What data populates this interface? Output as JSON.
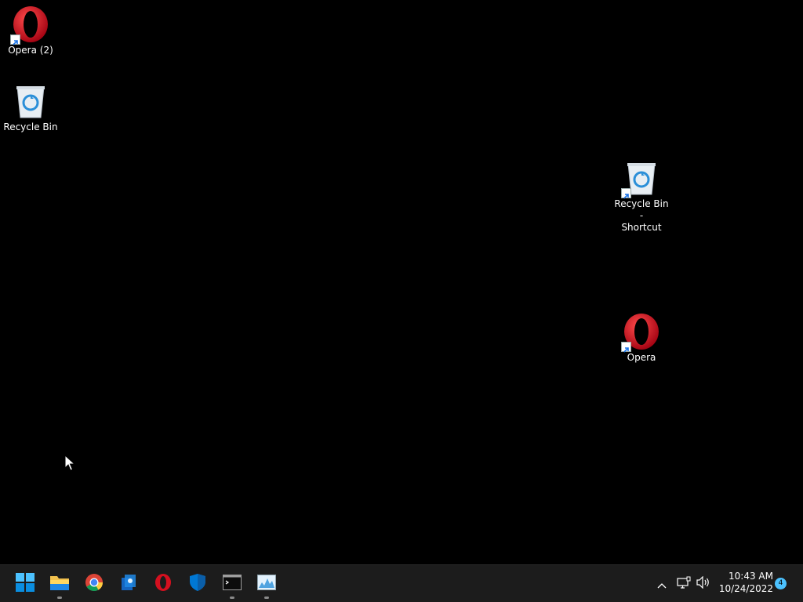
{
  "desktop": {
    "icons": [
      {
        "label": "Opera (2)",
        "icon": "opera-icon",
        "shortcut": true
      },
      {
        "label": "Recycle Bin",
        "icon": "recycle-bin-icon",
        "shortcut": false
      },
      {
        "label_line1": "Recycle Bin -",
        "label_line2": "Shortcut",
        "icon": "recycle-bin-icon",
        "shortcut": true
      },
      {
        "label": "Opera",
        "icon": "opera-icon",
        "shortcut": true
      }
    ]
  },
  "taskbar": {
    "apps": [
      {
        "name": "start",
        "icon": "windows-start-icon",
        "running": false
      },
      {
        "name": "file-explorer",
        "icon": "folder-icon",
        "running": true
      },
      {
        "name": "chrome",
        "icon": "chrome-icon",
        "running": false
      },
      {
        "name": "app",
        "icon": "app-icon",
        "running": false
      },
      {
        "name": "opera",
        "icon": "opera-icon",
        "running": false
      },
      {
        "name": "windows-security",
        "icon": "shield-icon",
        "running": false
      },
      {
        "name": "terminal",
        "icon": "terminal-icon",
        "running": true
      },
      {
        "name": "performance-monitor",
        "icon": "monitor-chart-icon",
        "running": true
      }
    ],
    "tray": {
      "time": "10:43 AM",
      "date": "10/24/2022",
      "notification_count": "4"
    }
  },
  "colors": {
    "desktop_background": "#000000",
    "taskbar_background": "#1c1c1c",
    "accent": "#4cc2ff"
  }
}
